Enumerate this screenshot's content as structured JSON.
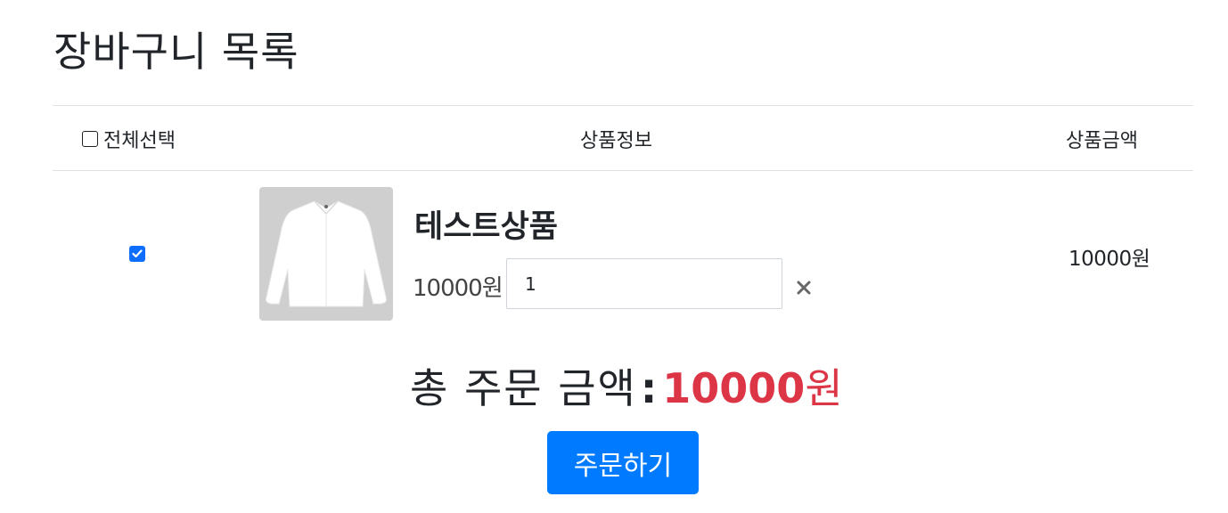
{
  "page": {
    "title": "장바구니 목록"
  },
  "table": {
    "headers": {
      "select_all": "전체선택",
      "product_info": "상품정보",
      "product_price": "상품금액"
    },
    "select_all_checked": false,
    "items": [
      {
        "checked": true,
        "image": "white-shirt-image",
        "name": "테스트상품",
        "unit_price": "10000원",
        "quantity": "1",
        "line_total": "10000원",
        "remove_icon": "close-icon"
      }
    ]
  },
  "summary": {
    "label": "총 주문 금액",
    "colon": ":",
    "amount": "10000",
    "unit": "원"
  },
  "actions": {
    "order_label": "주문하기"
  },
  "colors": {
    "accent": "#007bff",
    "total_amount": "#dc3545",
    "checkbox_checked": "#0d6efd"
  }
}
